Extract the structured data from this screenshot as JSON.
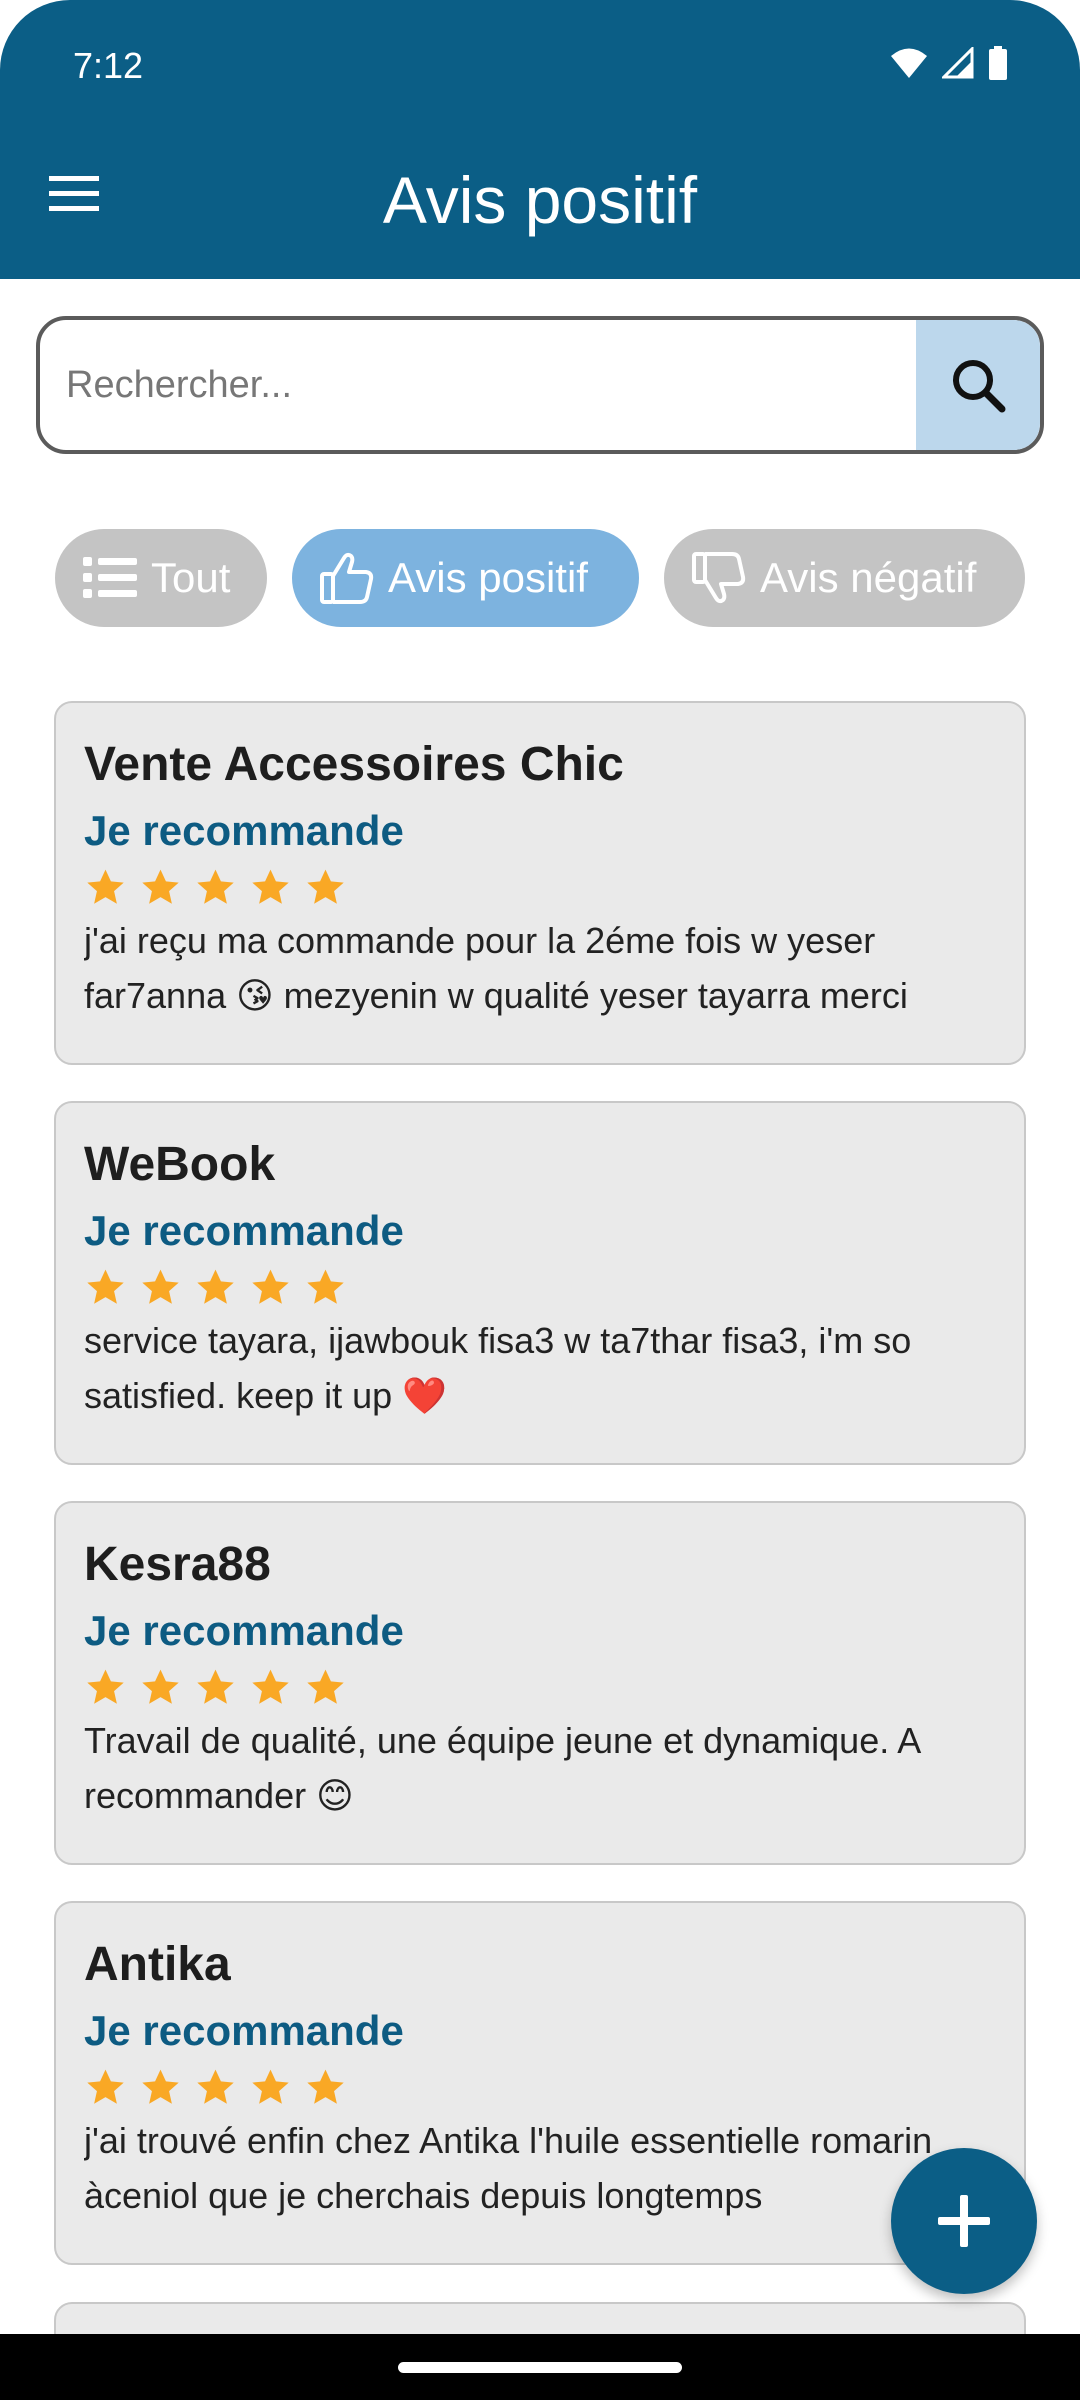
{
  "status_bar": {
    "time": "7:12"
  },
  "header": {
    "title": "Avis positif"
  },
  "search": {
    "placeholder": "Rechercher..."
  },
  "filters": [
    {
      "label": "Tout",
      "icon": "list-icon",
      "selected": false
    },
    {
      "label": "Avis positif",
      "icon": "thumbs-up-icon",
      "selected": true
    },
    {
      "label": "Avis négatif",
      "icon": "thumbs-down-icon",
      "selected": false
    }
  ],
  "reviews": [
    {
      "name": "Vente Accessoires Chic",
      "verdict": "Je recommande",
      "rating": 5,
      "text": "j'ai reçu ma commande pour la 2éme fois w yeser far7anna 😘 mezyenin w qualité yeser tayarra merci"
    },
    {
      "name": "WeBook",
      "verdict": "Je recommande",
      "rating": 5,
      "text": "service tayara, ijawbouk fisa3 w ta7thar fisa3, i'm so satisfied. keep it up ❤️"
    },
    {
      "name": "Kesra88",
      "verdict": "Je recommande",
      "rating": 5,
      "text": "Travail de qualité, une équipe jeune et dynamique. A recommander 😊"
    },
    {
      "name": "Antika",
      "verdict": "Je recommande",
      "rating": 5,
      "text": "j'ai trouvé enfin chez Antika l'huile essentielle romarin àceniol que je cherchais depuis longtemps"
    }
  ],
  "colors": {
    "primary": "#0b5e86",
    "chip_selected": "#7db3df",
    "chip_default": "#c4c4c4",
    "star": "#f9a825",
    "card_bg": "#eaeaea"
  }
}
